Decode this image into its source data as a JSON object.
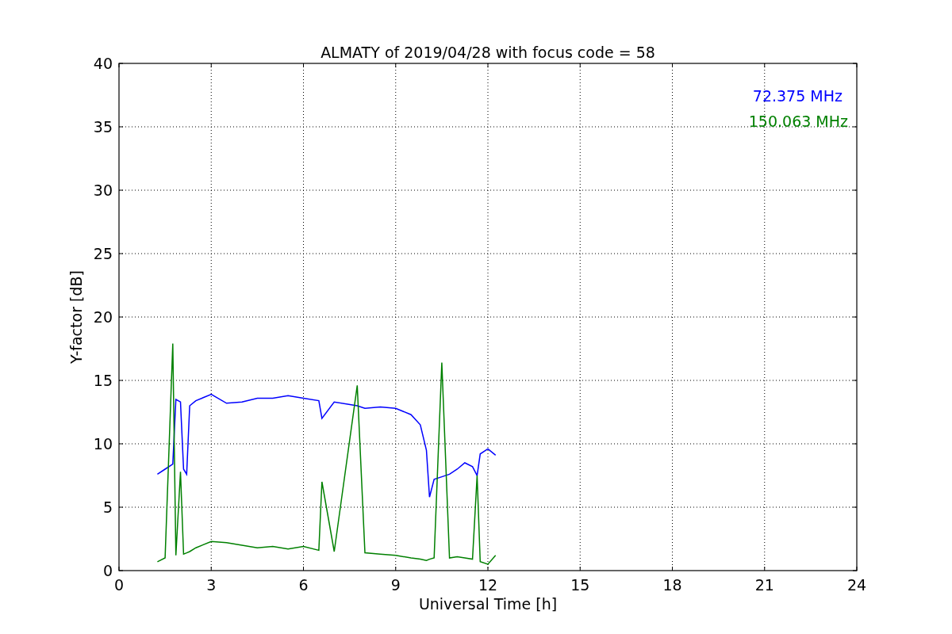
{
  "chart_data": {
    "type": "line",
    "title": "ALMATY of 2019/04/28 with focus code = 58",
    "xlabel": "Universal Time [h]",
    "ylabel": "Y-factor [dB]",
    "x": [
      1.25,
      1.5,
      1.75,
      1.85,
      2.0,
      2.1,
      2.2,
      2.3,
      2.5,
      3.0,
      3.5,
      4.0,
      4.5,
      5.0,
      5.5,
      6.0,
      6.5,
      6.6,
      7.0,
      7.75,
      8.0,
      8.5,
      9.0,
      9.5,
      9.8,
      10.0,
      10.1,
      10.25,
      10.5,
      10.75,
      11.0,
      11.25,
      11.5,
      11.65,
      11.75,
      12.0,
      12.25
    ],
    "series": [
      {
        "name": "72.375 MHz",
        "color": "#0000ff",
        "values": [
          7.6,
          8.0,
          8.4,
          13.5,
          13.3,
          8.0,
          7.6,
          13.0,
          13.4,
          13.9,
          13.2,
          13.3,
          13.6,
          13.6,
          13.8,
          13.6,
          13.4,
          12.0,
          13.3,
          13.0,
          12.8,
          12.9,
          12.8,
          12.3,
          11.5,
          9.5,
          5.8,
          7.2,
          7.4,
          7.6,
          8.0,
          8.5,
          8.2,
          7.5,
          9.2,
          9.6,
          9.1
        ]
      },
      {
        "name": "150.063 MHz",
        "color": "#008000",
        "values": [
          0.7,
          1.0,
          17.9,
          1.2,
          7.8,
          1.3,
          1.4,
          1.5,
          1.8,
          2.3,
          2.2,
          2.0,
          1.8,
          1.9,
          1.7,
          1.9,
          1.6,
          7.0,
          1.5,
          14.6,
          1.4,
          1.3,
          1.2,
          1.0,
          0.9,
          0.8,
          0.9,
          1.0,
          16.4,
          1.0,
          1.1,
          1.0,
          0.9,
          7.5,
          0.7,
          0.5,
          1.2
        ]
      }
    ],
    "grid": true,
    "xlim": [
      0,
      24
    ],
    "ylim": [
      0,
      40
    ],
    "xticks": [
      0,
      3,
      6,
      9,
      12,
      15,
      18,
      21,
      24
    ],
    "yticks": [
      0,
      5,
      10,
      15,
      20,
      25,
      30,
      35,
      40
    ]
  }
}
